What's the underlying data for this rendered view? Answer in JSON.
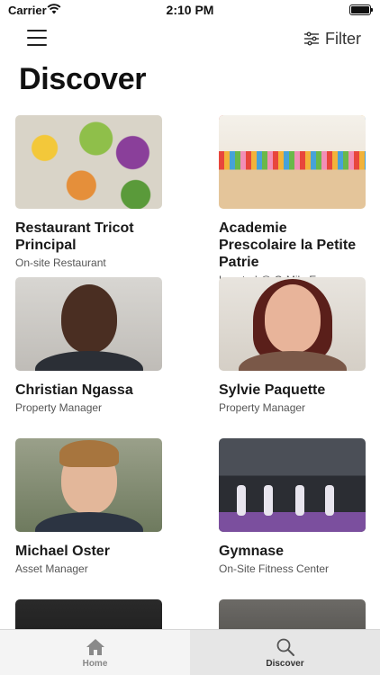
{
  "status": {
    "carrier": "Carrier",
    "time": "2:10 PM"
  },
  "nav": {
    "menu_icon": "hamburger-menu-icon",
    "filter_label": "Filter",
    "filter_icon": "sliders-icon"
  },
  "page": {
    "title": "Discover"
  },
  "cards": [
    {
      "name": "Restaurant Tricot Principal",
      "subtitle": "On-site Restaurant",
      "image": "salad-bowls-photo"
    },
    {
      "name": "Academie Prescolaire la Petite Patrie",
      "subtitle": "Located @ O-Mile Ex",
      "image": "colored-pencils-photo"
    },
    {
      "name": "Christian Ngassa",
      "subtitle": "Property Manager",
      "image": "portrait-photo"
    },
    {
      "name": "Sylvie Paquette",
      "subtitle": "Property Manager",
      "image": "portrait-photo"
    },
    {
      "name": "Michael Oster",
      "subtitle": "Asset Manager",
      "image": "portrait-photo"
    },
    {
      "name": "Gymnase",
      "subtitle": "On-Site Fitness Center",
      "image": "fitness-class-photo"
    }
  ],
  "tabbar": {
    "items": [
      {
        "label": "Home",
        "icon": "home-icon",
        "active": false
      },
      {
        "label": "Discover",
        "icon": "search-icon",
        "active": true
      }
    ]
  }
}
